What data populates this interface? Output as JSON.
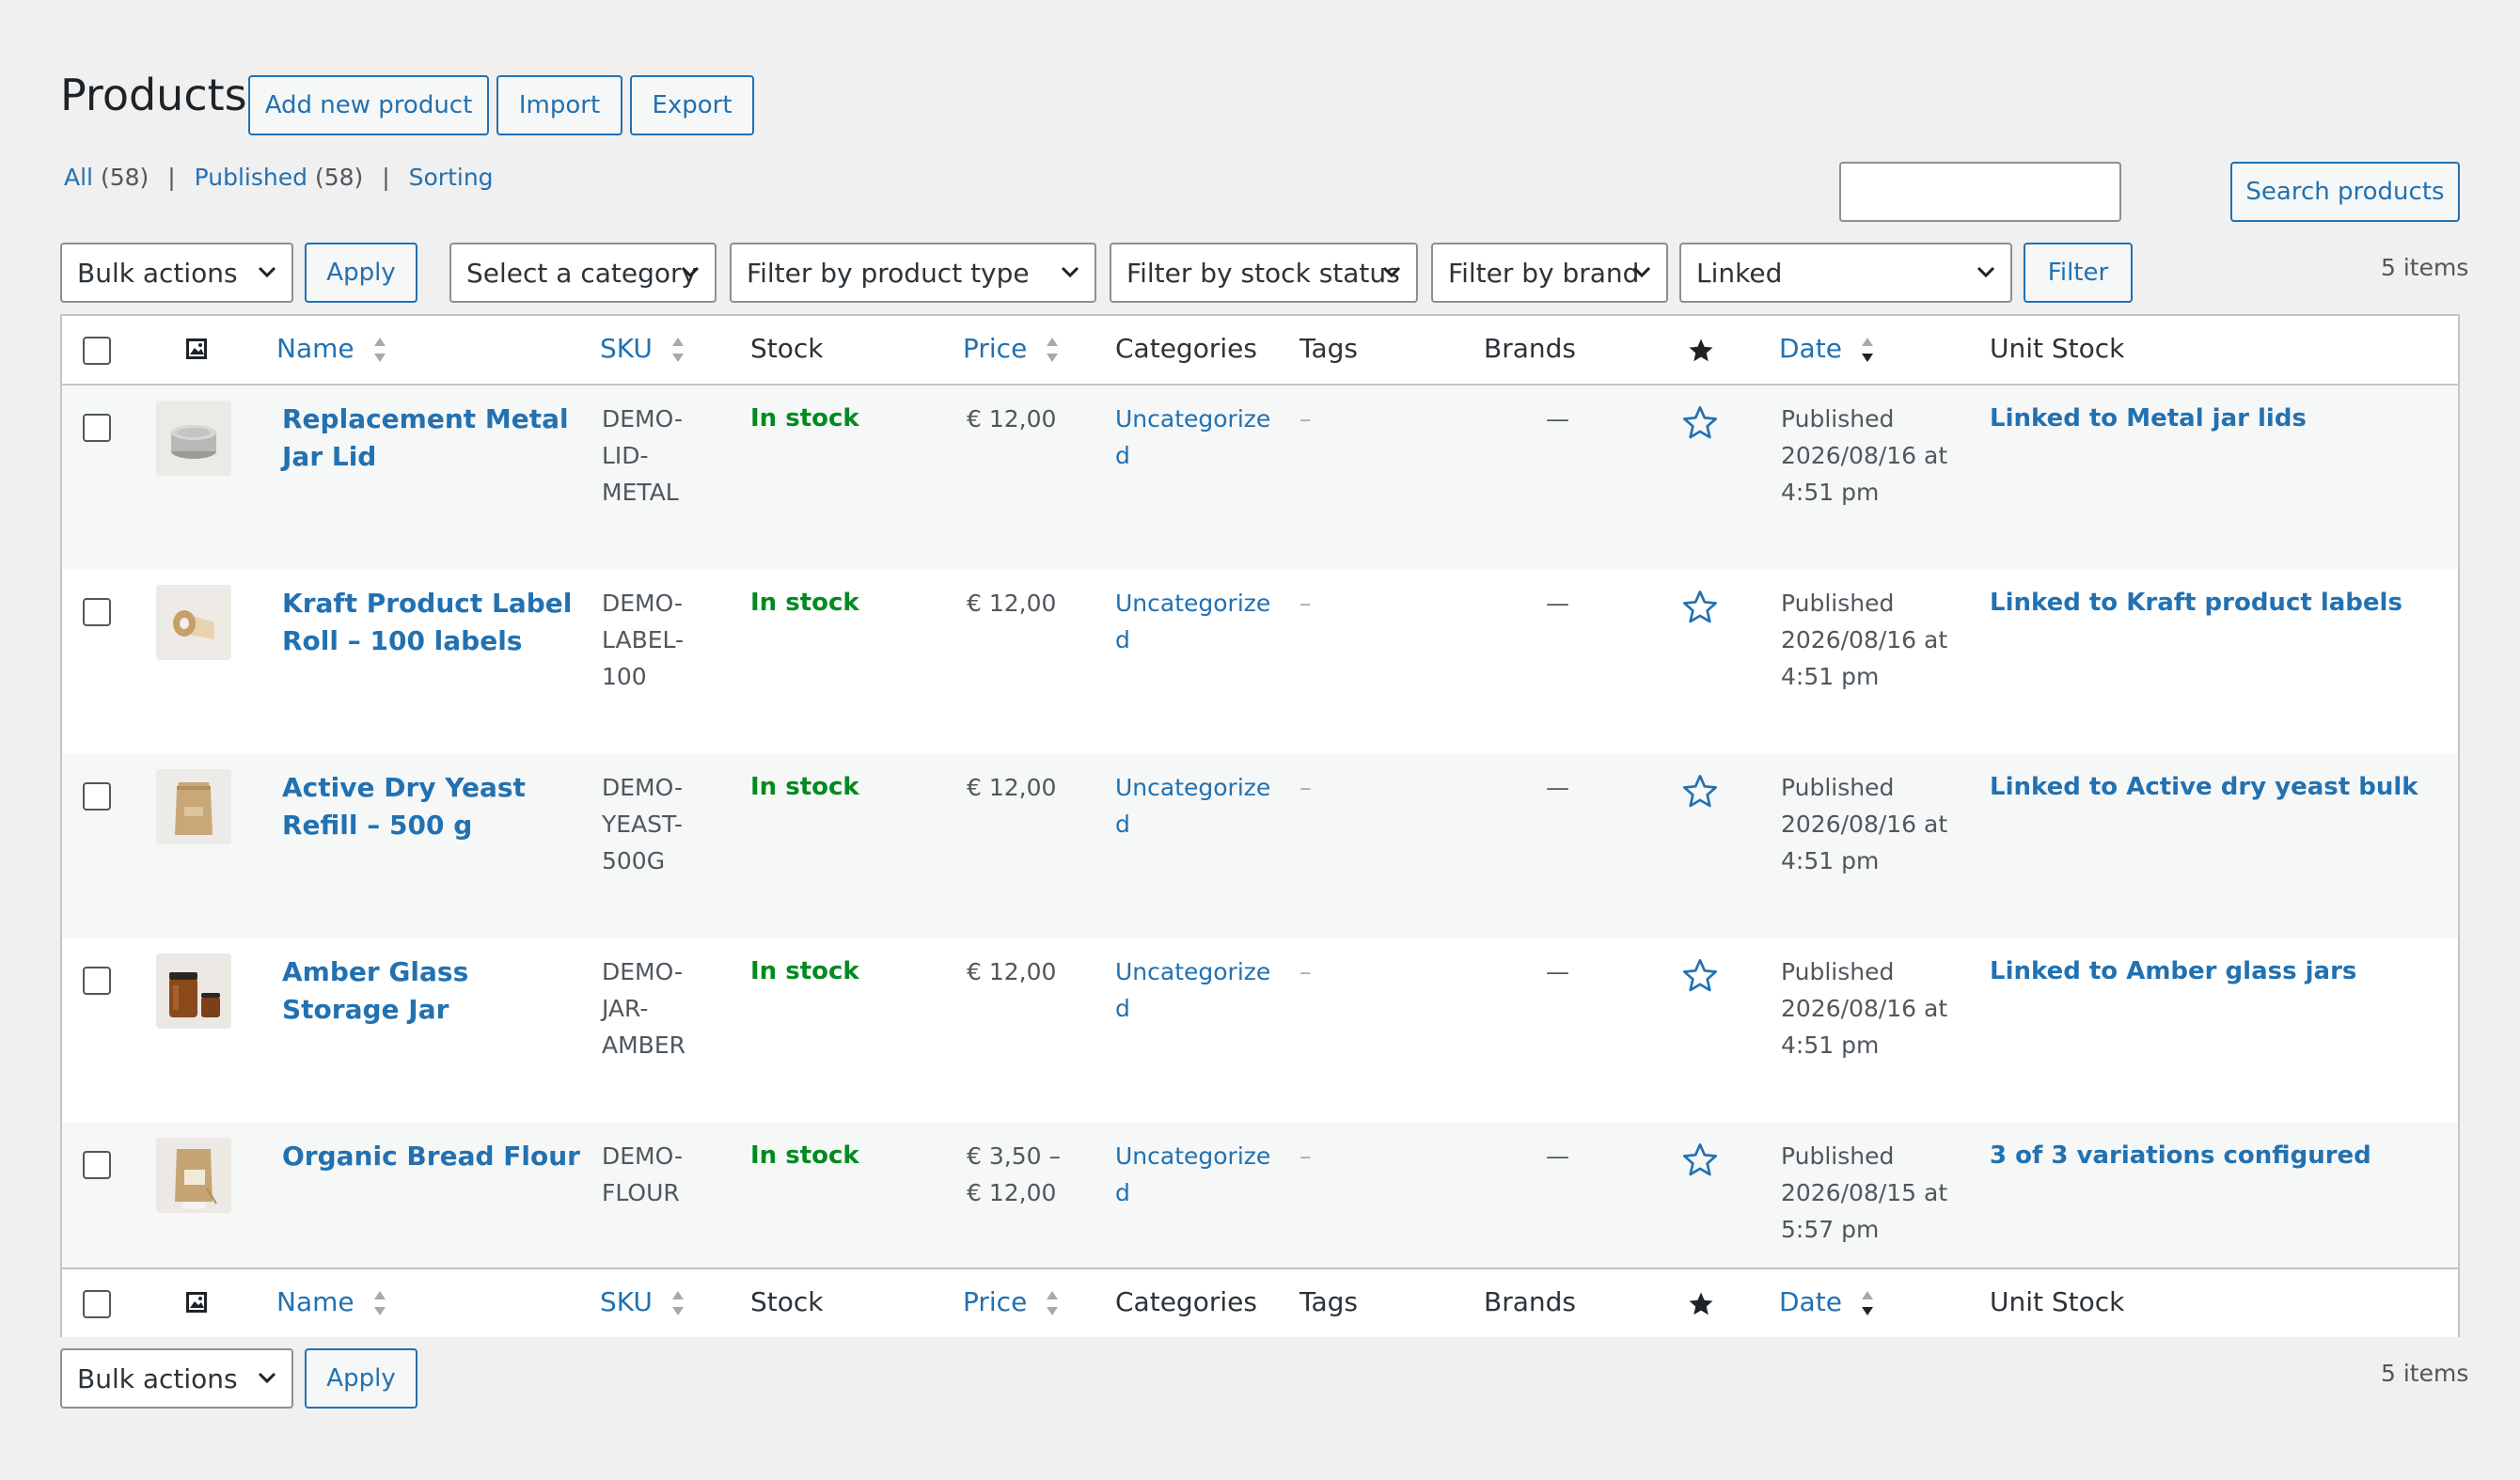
{
  "header": {
    "title": "Products",
    "add_new": "Add new product",
    "import": "Import",
    "export": "Export"
  },
  "views": {
    "all_label": "All",
    "all_count": "(58)",
    "published_label": "Published",
    "published_count": "(58)",
    "sorting_label": "Sorting",
    "separator": "|"
  },
  "search": {
    "button": "Search products",
    "value": ""
  },
  "filters": {
    "bulk_actions": "Bulk actions",
    "apply": "Apply",
    "category": "Select a category",
    "product_type": "Filter by product type",
    "stock_status": "Filter by stock status",
    "brand": "Filter by brand",
    "linked": "Linked",
    "filter_button": "Filter",
    "items_count": "5 items"
  },
  "columns": {
    "name": "Name",
    "sku": "SKU",
    "stock": "Stock",
    "price": "Price",
    "categories": "Categories",
    "tags": "Tags",
    "brands": "Brands",
    "date": "Date",
    "unit_stock": "Unit Stock"
  },
  "rows": [
    {
      "name": "Replacement Metal Jar Lid",
      "sku": "DEMO-LID-METAL",
      "stock": "In stock",
      "price": "€ 12,00",
      "category": "Uncategorized",
      "tags": "–",
      "brands": "—",
      "date_status": "Published",
      "date": "2026/08/16 at 4:51 pm",
      "unit_stock": "Linked to Metal jar lids",
      "thumb": "metal-lids"
    },
    {
      "name": "Kraft Product Label Roll – 100 labels",
      "sku": "DEMO-LABEL-100",
      "stock": "In stock",
      "price": "€ 12,00",
      "category": "Uncategorized",
      "tags": "–",
      "brands": "—",
      "date_status": "Published",
      "date": "2026/08/16 at 4:51 pm",
      "unit_stock": "Linked to Kraft product labels",
      "thumb": "label-roll"
    },
    {
      "name": "Active Dry Yeast Refill – 500 g",
      "sku": "DEMO-YEAST-500G",
      "stock": "In stock",
      "price": "€ 12,00",
      "category": "Uncategorized",
      "tags": "–",
      "brands": "—",
      "date_status": "Published",
      "date": "2026/08/16 at 4:51 pm",
      "unit_stock": "Linked to Active dry yeast bulk",
      "thumb": "yeast-pouch"
    },
    {
      "name": "Amber Glass Storage Jar",
      "sku": "DEMO-JAR-AMBER",
      "stock": "In stock",
      "price": "€ 12,00",
      "category": "Uncategorized",
      "tags": "–",
      "brands": "—",
      "date_status": "Published",
      "date": "2026/08/16 at 4:51 pm",
      "unit_stock": "Linked to Amber glass jars",
      "thumb": "amber-jar"
    },
    {
      "name": "Organic Bread Flour",
      "sku": "DEMO-FLOUR",
      "stock": "In stock",
      "price": "€ 3,50 – € 12,00",
      "category": "Uncategorized",
      "tags": "–",
      "brands": "—",
      "date_status": "Published",
      "date": "2026/08/15 at 5:57 pm",
      "unit_stock": "3 of 3 variations configured",
      "thumb": "flour-bag"
    }
  ],
  "colors": {
    "accent": "#2271b1",
    "in_stock": "#008a20",
    "background": "#f0f0f1"
  }
}
